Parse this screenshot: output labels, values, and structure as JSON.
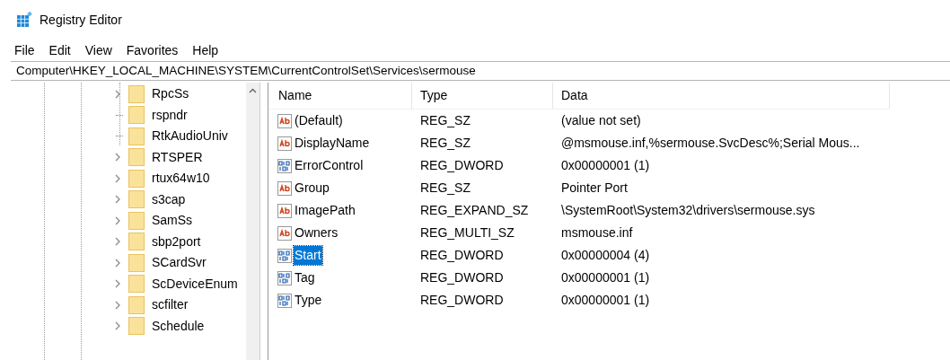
{
  "window": {
    "title": "Registry Editor"
  },
  "menu": [
    "File",
    "Edit",
    "View",
    "Favorites",
    "Help"
  ],
  "address": "Computer\\HKEY_LOCAL_MACHINE\\SYSTEM\\CurrentControlSet\\Services\\sermouse",
  "tree": [
    {
      "label": "RpcSs",
      "expandable": true
    },
    {
      "label": "rspndr",
      "expandable": false
    },
    {
      "label": "RtkAudioUniv",
      "expandable": false
    },
    {
      "label": "RTSPER",
      "expandable": true
    },
    {
      "label": "rtux64w10",
      "expandable": true
    },
    {
      "label": "s3cap",
      "expandable": true
    },
    {
      "label": "SamSs",
      "expandable": true
    },
    {
      "label": "sbp2port",
      "expandable": true
    },
    {
      "label": "SCardSvr",
      "expandable": true
    },
    {
      "label": "ScDeviceEnum",
      "expandable": true
    },
    {
      "label": "scfilter",
      "expandable": true
    },
    {
      "label": "Schedule",
      "expandable": true
    }
  ],
  "columns": [
    "Name",
    "Type",
    "Data"
  ],
  "values": [
    {
      "kind": "string",
      "name": "(Default)",
      "type": "REG_SZ",
      "data": "(value not set)",
      "selected": false
    },
    {
      "kind": "string",
      "name": "DisplayName",
      "type": "REG_SZ",
      "data": "@msmouse.inf,%sermouse.SvcDesc%;Serial Mous...",
      "selected": false
    },
    {
      "kind": "binary",
      "name": "ErrorControl",
      "type": "REG_DWORD",
      "data": "0x00000001 (1)",
      "selected": false
    },
    {
      "kind": "string",
      "name": "Group",
      "type": "REG_SZ",
      "data": "Pointer Port",
      "selected": false
    },
    {
      "kind": "string",
      "name": "ImagePath",
      "type": "REG_EXPAND_SZ",
      "data": "\\SystemRoot\\System32\\drivers\\sermouse.sys",
      "selected": false
    },
    {
      "kind": "string",
      "name": "Owners",
      "type": "REG_MULTI_SZ",
      "data": "msmouse.inf",
      "selected": false
    },
    {
      "kind": "binary",
      "name": "Start",
      "type": "REG_DWORD",
      "data": "0x00000004 (4)",
      "selected": true
    },
    {
      "kind": "binary",
      "name": "Tag",
      "type": "REG_DWORD",
      "data": "0x00000001 (1)",
      "selected": false
    },
    {
      "kind": "binary",
      "name": "Type",
      "type": "REG_DWORD",
      "data": "0x00000001 (1)",
      "selected": false
    }
  ]
}
